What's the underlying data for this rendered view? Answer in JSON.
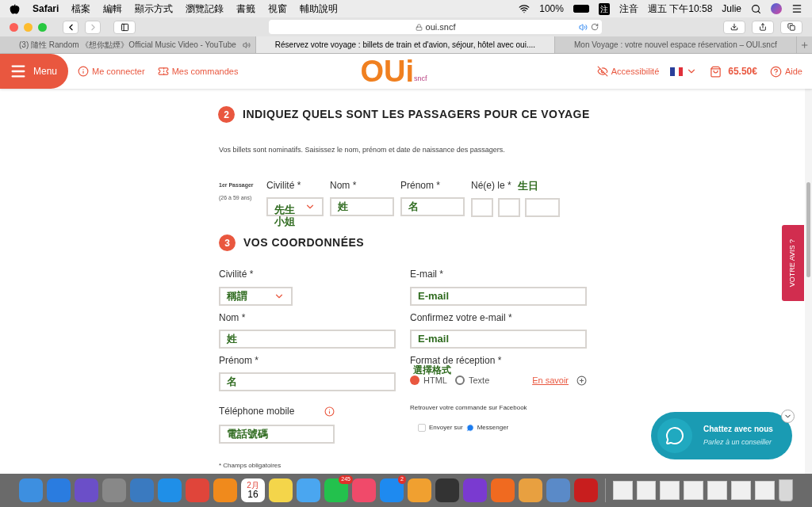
{
  "menubar": {
    "app": "Safari",
    "menus": [
      "檔案",
      "編輯",
      "顯示方式",
      "瀏覽記錄",
      "書籤",
      "視窗",
      "輔助說明"
    ],
    "battery": "100%",
    "input_method_icon": "注",
    "input_method": "注音",
    "clock": "週五 下午10:58",
    "user": "Julie"
  },
  "browser": {
    "address": "oui.sncf",
    "tabs": [
      {
        "label": "(3) 隨性 Random 《想你點煙》Official Music Video - YouTube",
        "selected": false,
        "audio": true
      },
      {
        "label": "Réservez votre voyage : billets de train et d'avion, séjour, hôtel avec oui....",
        "selected": true,
        "audio": false
      },
      {
        "label": "Mon Voyage : votre nouvel espace réservation – OUI.sncf",
        "selected": false,
        "audio": false
      }
    ]
  },
  "site_header": {
    "menu": "Menu",
    "login": "Me connecter",
    "orders": "Mes commandes",
    "logo": "OUi",
    "logo_sub": "sncf",
    "accessibility": "Accessibilité",
    "cart": "65.50€",
    "help": "Aide"
  },
  "passengers": {
    "number": "2",
    "title": "INDIQUEZ QUELS SONT LES PASSAGERS POUR CE VOYAGE",
    "note": "Vos billets sont nominatifs. Saisissez le nom, prénom et date de naissance des passagers.",
    "passenger_label": "1er Passager",
    "age": "(26 à 59 ans)",
    "civility_label": "Civilité *",
    "civility_value": "先生",
    "civility_overflow": "小姐",
    "nom_label": "Nom *",
    "nom_value": "姓",
    "prenom_label": "Prénom *",
    "prenom_value": "名",
    "birth_label": "Né(e) le *",
    "birth_annotation": "生日"
  },
  "contact": {
    "number": "3",
    "title": "VOS COORDONNÉES",
    "civility_label": "Civilité *",
    "civility_value": "稱謂",
    "nom_label": "Nom *",
    "nom_value": "姓",
    "prenom_label": "Prénom *",
    "prenom_value": "名",
    "phone_label": "Téléphone mobile",
    "phone_value": "電話號碼",
    "email_label": "E-mail *",
    "email_value": "E-mail",
    "confirm_label": "Confirmez votre e-mail *",
    "confirm_value": "E-mail",
    "format_label": "Format de réception *",
    "format_annotation": "選擇格式",
    "formats": [
      {
        "label": "HTML",
        "selected": true
      },
      {
        "label": "Texte",
        "selected": false
      }
    ],
    "learn_more": "En savoir",
    "facebook_note": "Retrouver votre commande sur Facebook",
    "messenger_checked": false,
    "send_on": "Envoyer sur",
    "messenger": "Messenger",
    "required_note": "* Champs obligatoires"
  },
  "feedback_tab": "VOTRE AVIS ?",
  "chat": {
    "title": "Chattez avec nous",
    "subtitle": "Parlez à un conseiller"
  },
  "dock": {
    "calendar_month": "2月",
    "calendar_day": "16",
    "line_badge": "245",
    "appstore_badge": "2"
  }
}
